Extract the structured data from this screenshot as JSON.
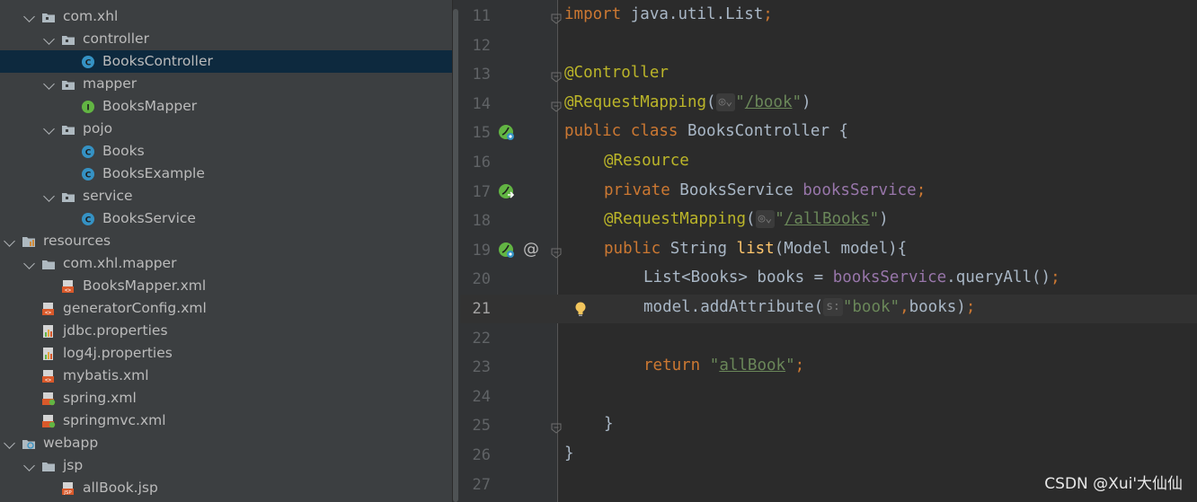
{
  "project_tree": [
    {
      "label": "com.xhl",
      "depth": 1,
      "icon": "package-folder-icon",
      "expanded": true,
      "selected": false
    },
    {
      "label": "controller",
      "depth": 2,
      "icon": "package-folder-icon",
      "expanded": true,
      "selected": false
    },
    {
      "label": "BooksController",
      "depth": 3,
      "icon": "class-icon",
      "expanded": null,
      "selected": true
    },
    {
      "label": "mapper",
      "depth": 2,
      "icon": "package-folder-icon",
      "expanded": true,
      "selected": false
    },
    {
      "label": "BooksMapper",
      "depth": 3,
      "icon": "interface-icon",
      "expanded": null,
      "selected": false
    },
    {
      "label": "pojo",
      "depth": 2,
      "icon": "package-folder-icon",
      "expanded": true,
      "selected": false
    },
    {
      "label": "Books",
      "depth": 3,
      "icon": "class-icon",
      "expanded": null,
      "selected": false
    },
    {
      "label": "BooksExample",
      "depth": 3,
      "icon": "class-icon",
      "expanded": null,
      "selected": false
    },
    {
      "label": "service",
      "depth": 2,
      "icon": "package-folder-icon",
      "expanded": true,
      "selected": false
    },
    {
      "label": "BooksService",
      "depth": 3,
      "icon": "class-icon",
      "expanded": null,
      "selected": false
    },
    {
      "label": "resources",
      "depth": 0,
      "icon": "resources-folder-icon",
      "expanded": true,
      "selected": false
    },
    {
      "label": "com.xhl.mapper",
      "depth": 1,
      "icon": "folder-icon",
      "expanded": true,
      "selected": false
    },
    {
      "label": "BooksMapper.xml",
      "depth": 2,
      "icon": "xml-file-icon",
      "expanded": null,
      "selected": false
    },
    {
      "label": "generatorConfig.xml",
      "depth": 1,
      "icon": "xml-file-icon",
      "expanded": null,
      "selected": false
    },
    {
      "label": "jdbc.properties",
      "depth": 1,
      "icon": "properties-file-icon",
      "expanded": null,
      "selected": false
    },
    {
      "label": "log4j.properties",
      "depth": 1,
      "icon": "properties-file-icon",
      "expanded": null,
      "selected": false
    },
    {
      "label": "mybatis.xml",
      "depth": 1,
      "icon": "xml-file-icon",
      "expanded": null,
      "selected": false
    },
    {
      "label": "spring.xml",
      "depth": 1,
      "icon": "spring-xml-icon",
      "expanded": null,
      "selected": false
    },
    {
      "label": "springmvc.xml",
      "depth": 1,
      "icon": "spring-xml-icon",
      "expanded": null,
      "selected": false
    },
    {
      "label": "webapp",
      "depth": 0,
      "icon": "web-folder-icon",
      "expanded": true,
      "selected": false
    },
    {
      "label": "jsp",
      "depth": 1,
      "icon": "folder-icon",
      "expanded": true,
      "selected": false
    },
    {
      "label": "allBook.jsp",
      "depth": 2,
      "icon": "jsp-file-icon",
      "expanded": null,
      "selected": false
    }
  ],
  "editor": {
    "current_line": 21,
    "lines": [
      {
        "n": "11",
        "segs": [
          [
            "k",
            "import "
          ],
          [
            "",
            "java.util.List"
          ],
          [
            "k",
            ";"
          ]
        ],
        "indent": 0,
        "gutter": "",
        "fold": true
      },
      {
        "n": "12",
        "segs": [],
        "indent": 0,
        "gutter": "",
        "fold": false
      },
      {
        "n": "13",
        "segs": [
          [
            "a",
            "@Controller"
          ]
        ],
        "indent": 0,
        "gutter": "",
        "fold": true
      },
      {
        "n": "14",
        "segs": [
          [
            "a",
            "@RequestMapping"
          ],
          [
            "",
            "("
          ],
          [
            "globe",
            "◎⌄"
          ],
          [
            "s",
            "\""
          ],
          [
            "su",
            "/book"
          ],
          [
            "s",
            "\""
          ],
          [
            "",
            ")"
          ]
        ],
        "indent": 0,
        "gutter": "",
        "fold": true
      },
      {
        "n": "15",
        "segs": [
          [
            "k",
            "public class "
          ],
          [
            "",
            "BooksController {"
          ]
        ],
        "indent": 0,
        "gutter": "spring-bean-icon",
        "fold": false
      },
      {
        "n": "16",
        "segs": [
          [
            "a",
            "@Resource"
          ]
        ],
        "indent": 1,
        "gutter": "",
        "fold": false
      },
      {
        "n": "17",
        "segs": [
          [
            "k",
            "private "
          ],
          [
            "",
            "BooksService "
          ],
          [
            "f",
            "booksService"
          ],
          [
            "k",
            ";"
          ]
        ],
        "indent": 1,
        "gutter": "spring-inject-icon",
        "fold": false
      },
      {
        "n": "18",
        "segs": [
          [
            "a",
            "@RequestMapping"
          ],
          [
            "",
            "("
          ],
          [
            "globe",
            "◎⌄"
          ],
          [
            "s",
            "\""
          ],
          [
            "su",
            "/allBooks"
          ],
          [
            "s",
            "\""
          ],
          [
            "",
            ")"
          ]
        ],
        "indent": 1,
        "gutter": "",
        "fold": false
      },
      {
        "n": "19",
        "segs": [
          [
            "k",
            "public "
          ],
          [
            "",
            "String "
          ],
          [
            "m",
            "list"
          ],
          [
            "",
            "(Model model){"
          ]
        ],
        "indent": 1,
        "gutter": "spring-mapping-icon",
        "fold": true
      },
      {
        "n": "20",
        "segs": [
          [
            "",
            "List<Books> books = "
          ],
          [
            "f",
            "booksService"
          ],
          [
            "",
            ".queryAll()"
          ],
          [
            "k",
            ";"
          ]
        ],
        "indent": 2,
        "gutter": "",
        "fold": false
      },
      {
        "n": "21",
        "segs": [
          [
            "",
            "model.addAttribute("
          ],
          [
            "hint",
            "s:"
          ],
          [
            "s",
            "\"book\""
          ],
          [
            "k",
            ","
          ],
          [
            "",
            "books)"
          ],
          [
            "k",
            ";"
          ]
        ],
        "indent": 2,
        "gutter": "lightbulb-icon",
        "fold": false
      },
      {
        "n": "22",
        "segs": [],
        "indent": 0,
        "gutter": "",
        "fold": false
      },
      {
        "n": "23",
        "segs": [
          [
            "k",
            "return "
          ],
          [
            "s",
            "\""
          ],
          [
            "su",
            "allBook"
          ],
          [
            "s",
            "\""
          ],
          [
            "k",
            ";"
          ]
        ],
        "indent": 2,
        "gutter": "",
        "fold": false
      },
      {
        "n": "24",
        "segs": [],
        "indent": 0,
        "gutter": "",
        "fold": false
      },
      {
        "n": "25",
        "segs": [
          [
            "",
            "}"
          ]
        ],
        "indent": 1,
        "gutter": "",
        "fold": true
      },
      {
        "n": "26",
        "segs": [
          [
            "",
            "}"
          ]
        ],
        "indent": 0,
        "gutter": "",
        "fold": false
      },
      {
        "n": "27",
        "segs": [],
        "indent": 0,
        "gutter": "",
        "fold": false
      }
    ]
  },
  "watermark": "CSDN @Xui'大仙仙",
  "colors": {
    "keyword": "#cc7832",
    "annotation": "#bbb529",
    "string": "#6a8759",
    "field": "#9876aa",
    "method": "#ffc66d",
    "selection": "#0d293e"
  }
}
